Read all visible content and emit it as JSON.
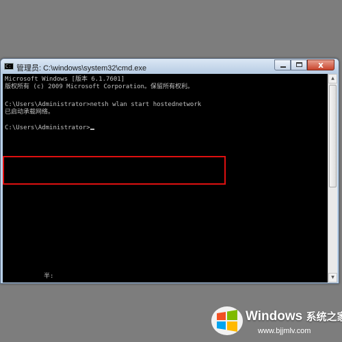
{
  "window": {
    "title": "管理员: C:\\windows\\system32\\cmd.exe",
    "close_label": "x"
  },
  "console": {
    "lines": [
      "Microsoft Windows [版本 6.1.7601]",
      "版权所有 (c) 2009 Microsoft Corporation。保留所有权利。",
      "C:\\Users\\Administrator>netsh wlan start hostednetwork",
      "已启动承载网络。",
      "C:\\Users\\Administrator>"
    ],
    "ime_indicator": "半:"
  },
  "watermark": {
    "brand": "Windows",
    "brand_cn": "系统之家",
    "url": "www.bjjmlv.com"
  },
  "colors": {
    "console_bg": "#000000",
    "console_text": "#c0c0c0",
    "highlight": "#e01010"
  }
}
